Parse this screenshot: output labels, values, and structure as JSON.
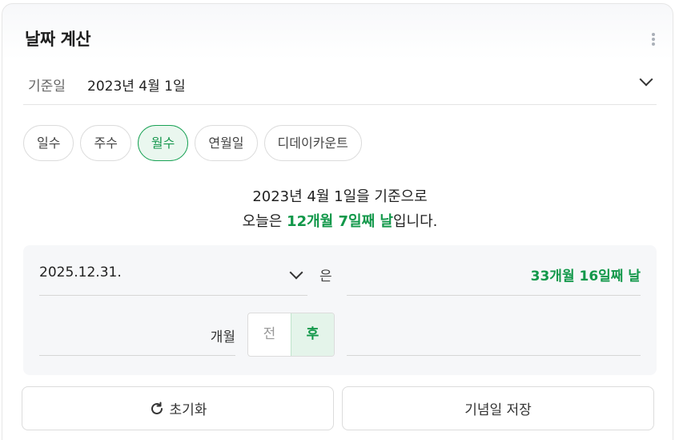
{
  "header": {
    "title": "날짜 계산"
  },
  "base": {
    "label": "기준일",
    "value": "2023년 4월 1일"
  },
  "tabs": [
    {
      "label": "일수",
      "active": false
    },
    {
      "label": "주수",
      "active": false
    },
    {
      "label": "월수",
      "active": true
    },
    {
      "label": "연월일",
      "active": false
    },
    {
      "label": "디데이카운트",
      "active": false
    }
  ],
  "summary": {
    "line1": "2023년 4월 1일을 기준으로",
    "line2_prefix": "오늘은 ",
    "line2_highlight": "12개월 7일째 날",
    "line2_suffix": "입니다."
  },
  "calc": {
    "date_value": "2025.12.31.",
    "particle": "은",
    "result": "33개월 16일째 날",
    "months_unit": "개월",
    "before_label": "전",
    "after_label": "후",
    "selected": "후"
  },
  "buttons": {
    "reset_label": "초기화",
    "save_label": "기념일 저장"
  },
  "colors": {
    "accent": "#12984a",
    "accent_bg": "#eaf7ef"
  }
}
